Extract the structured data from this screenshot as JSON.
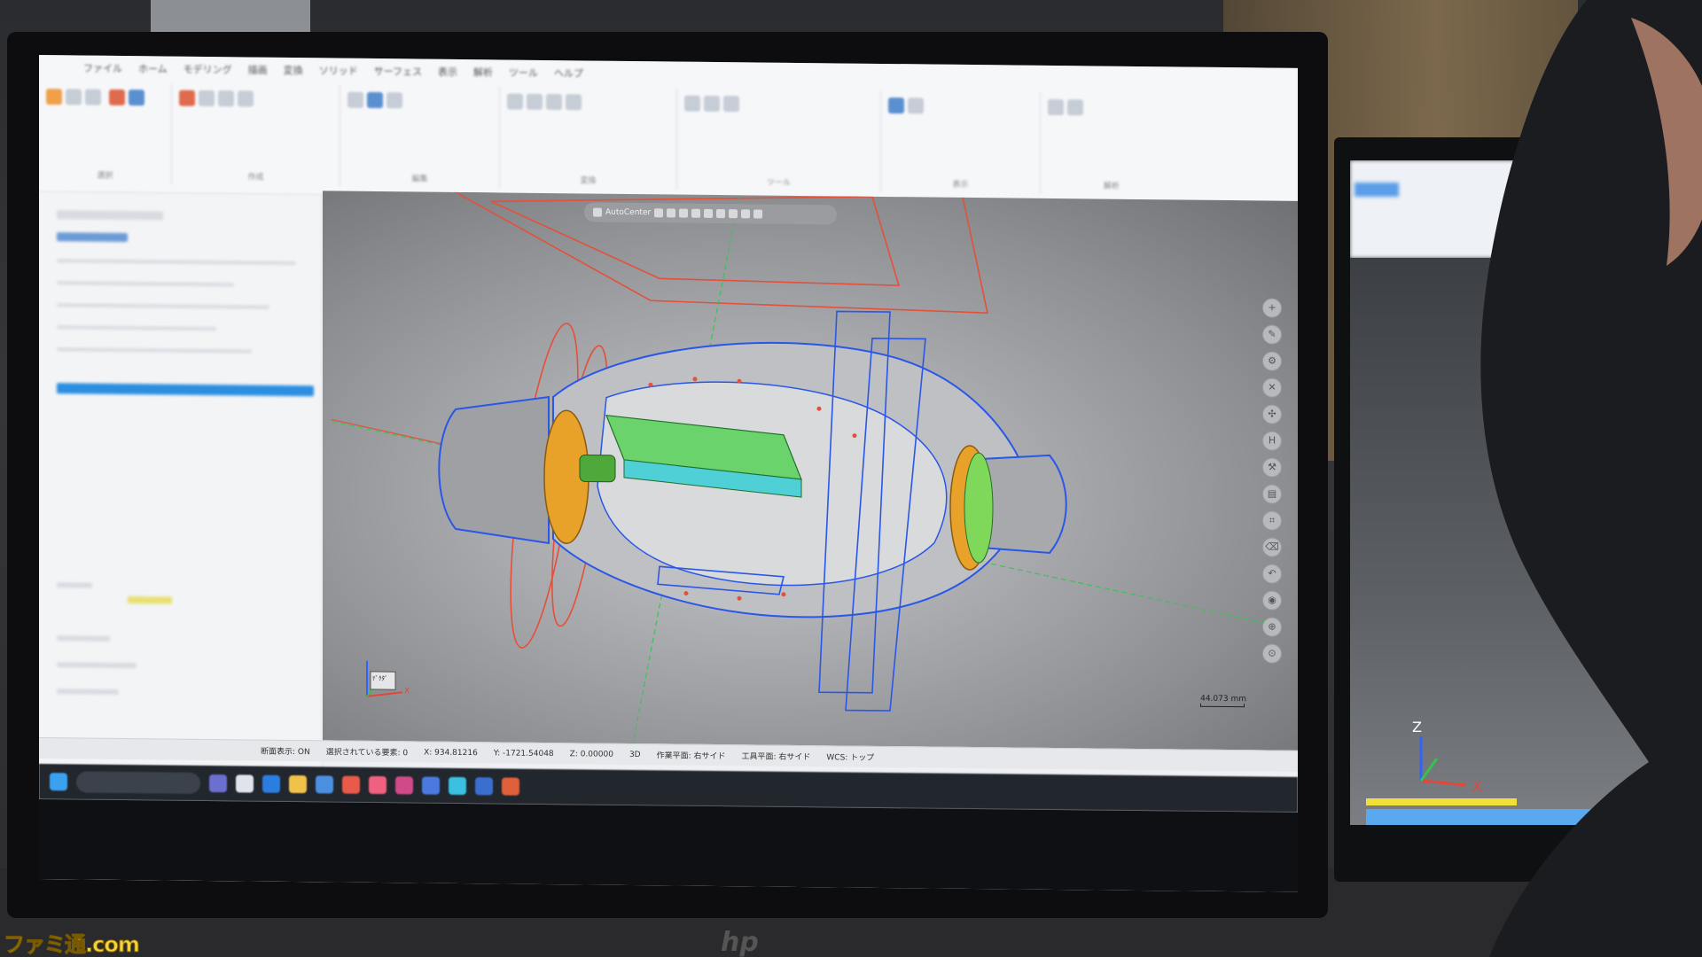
{
  "app": {
    "menu": [
      "ファイル",
      "ホーム",
      "モデリング",
      "描画",
      "変換",
      "ソリッド",
      "サーフェス",
      "表示",
      "解析",
      "ツール",
      "ヘルプ"
    ],
    "ribbon_groups": [
      "選択",
      "作成",
      "編集",
      "変換",
      "ツール",
      "表示",
      "解析"
    ]
  },
  "viewport": {
    "toolbar_label": "AutoCenter",
    "scale_label": "44.073 mm",
    "triad_label": "ﾃﾞｸﾀﾞ",
    "axis_x": "X",
    "axis_y": "Y",
    "axis_z": "Z",
    "colors": {
      "background": "#a3a5a9",
      "body": "#bfc0c3",
      "wire_blue": "#2a57e8",
      "wire_red": "#e4503a",
      "accent_orange": "#e8a22a",
      "accent_green": "#6bd36b",
      "accent_cyan": "#4fd0d6"
    }
  },
  "statusbar": {
    "section_view": "断面表示: ON",
    "selected": "選択されている要素: 0",
    "x": "X: 934.81216",
    "y": "Y: -1721.54048",
    "z": "Z: 0.00000",
    "mode": "3D",
    "work_plane": "作業平面: 右サイド",
    "tool_plane": "工具平面: 右サイド",
    "wcs": "WCS: トップ"
  },
  "watermark": "ファミ通.com"
}
